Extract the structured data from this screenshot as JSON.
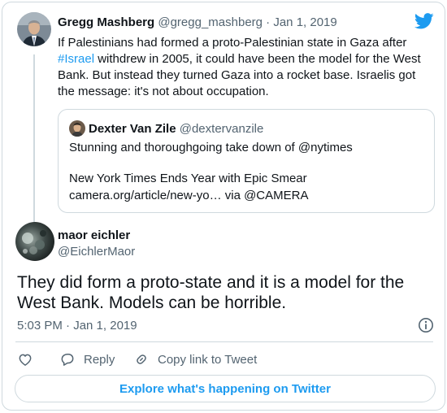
{
  "parent_tweet": {
    "author_name": "Gregg Mashberg",
    "author_handle": "@gregg_mashberg",
    "separator": "·",
    "date": "Jan 1, 2019",
    "text_before_hashtag": "If Palestinians had formed a proto-Palestinian state in Gaza after ",
    "hashtag": "#Israel",
    "text_after_hashtag": " withdrew in 2005, it could have been the model for the West Bank.  But instead they turned Gaza into a rocket base. Israelis got the message: it's not about occupation."
  },
  "quoted_tweet": {
    "author_name": "Dexter Van Zile",
    "author_handle": "@dextervanzile",
    "line1": "Stunning and thoroughgoing take down of @nytimes",
    "line2": "New York Times Ends Year with Epic Smear",
    "line3": "camera.org/article/new-yo… via @CAMERA"
  },
  "main_tweet": {
    "author_name": "maor eichler",
    "author_handle": "@EichlerMaor",
    "text": "They did form a proto-state and it is a model for the West Bank. Models can be horrible.",
    "timestamp": "5:03 PM · Jan 1, 2019"
  },
  "actions": {
    "reply_label": "Reply",
    "copy_link_label": "Copy link to Tweet"
  },
  "footer": {
    "explore_label": "Explore what's happening on Twitter"
  },
  "icons": {
    "brand": "twitter-bird-icon",
    "info": "info-icon",
    "like": "heart-icon",
    "reply": "speech-bubble-icon",
    "copy_link": "link-icon"
  },
  "colors": {
    "accent": "#1d9bf0",
    "text": "#0f1419",
    "muted": "#536471",
    "border": "#cfd9de"
  }
}
